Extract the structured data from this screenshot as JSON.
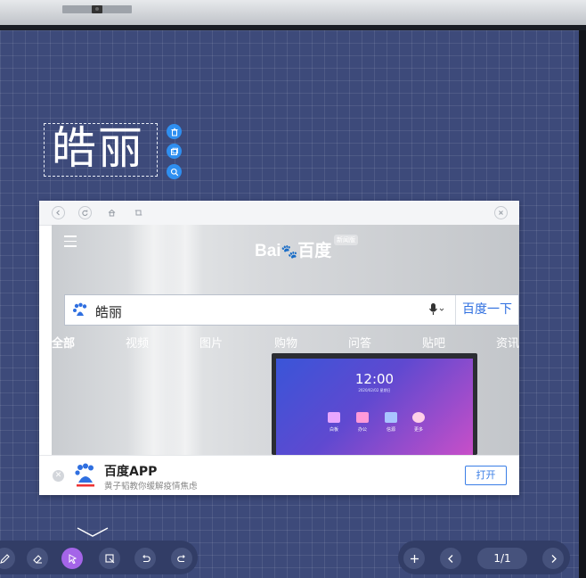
{
  "handwriting": {
    "text": "皓丽"
  },
  "selection_tools": [
    "trash-icon",
    "copy-icon",
    "zoom-icon"
  ],
  "browser": {
    "nav_icons": [
      "back-icon",
      "forward-icon",
      "home-icon",
      "crop-icon"
    ],
    "close_icon": "close-icon",
    "logo": {
      "text": "Bai",
      "du_text": "du",
      "suffix": "百度",
      "tag": "新闻版"
    },
    "search": {
      "value": "皓丽",
      "button": "百度一下"
    },
    "tabs": [
      "全部",
      "视频",
      "图片",
      "购物",
      "问答",
      "贴吧",
      "资讯"
    ],
    "monitor": {
      "time": "12:00",
      "date": "2020/02/02 星期日",
      "apps": [
        "白板",
        "办公",
        "信源",
        "更多"
      ]
    },
    "app_banner": {
      "name": "百度APP",
      "desc": "黄子韬教你缓解疫情焦虑",
      "open": "打开"
    }
  },
  "toolbar": {
    "left_tools": [
      "pen-icon",
      "eraser-icon",
      "select-icon",
      "insert-icon",
      "undo-icon",
      "redo-icon"
    ],
    "active_tool": "select-icon",
    "right_tools": [
      "add-page-icon",
      "prev-page-icon",
      "next-page-icon"
    ],
    "page_indicator": "1/1"
  },
  "colors": {
    "board": "#3d4a7a",
    "accent": "#2f8ff0",
    "active_tool": "#a465e8",
    "baidu_blue": "#2f6fe0"
  }
}
